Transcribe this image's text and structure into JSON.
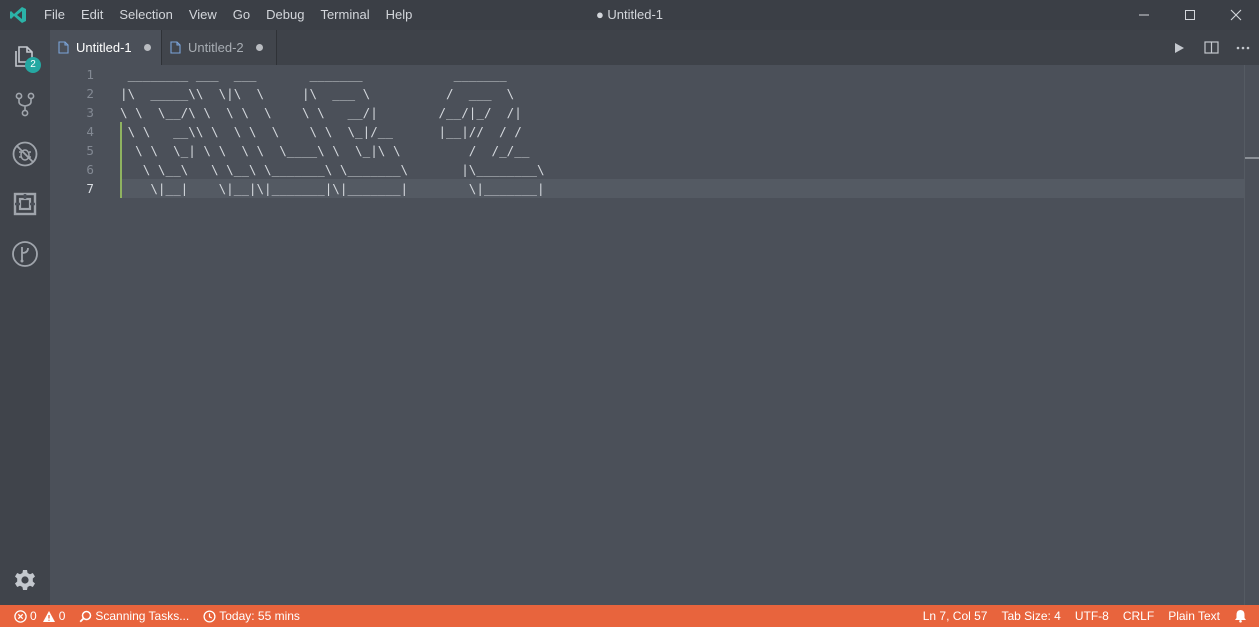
{
  "titlebar": {
    "menu": [
      "File",
      "Edit",
      "Selection",
      "View",
      "Go",
      "Debug",
      "Terminal",
      "Help"
    ],
    "title": "● Untitled-1",
    "controls": [
      "minimize-icon",
      "maximize-icon",
      "close-icon"
    ]
  },
  "activitybar": {
    "items": [
      "files-icon",
      "source-control-icon",
      "no-debug-icon",
      "extensions-icon",
      "git-graph-icon"
    ],
    "explorer_badge": "2",
    "bottom": "settings-gear-icon"
  },
  "tabs": [
    {
      "label": "Untitled-1",
      "active": true,
      "dirty": true
    },
    {
      "label": "Untitled-2",
      "active": false,
      "dirty": true
    }
  ],
  "editor_actions": [
    "run-icon",
    "split-editor-icon",
    "more-actions-icon"
  ],
  "editor": {
    "line_numbers": [
      "1",
      "2",
      "3",
      "4",
      "5",
      "6",
      "7"
    ],
    "current_line": 7,
    "lines": [
      " ________ ___  ___       _______            _______",
      "|\\  _____\\\\  \\|\\  \\     |\\  ___ \\          /  ___  \\",
      "\\ \\  \\__/\\ \\  \\ \\  \\    \\ \\   __/|        /__/|_/  /|",
      " \\ \\   __\\\\ \\  \\ \\  \\    \\ \\  \\_|/__      |__|//  / /",
      "  \\ \\  \\_| \\ \\  \\ \\  \\____\\ \\  \\_|\\ \\         /  /_/__",
      "   \\ \\__\\   \\ \\__\\ \\_______\\ \\_______\\       |\\________\\",
      "    \\|__|    \\|__|\\|_______|\\|_______|        \\|_______|"
    ]
  },
  "statusbar": {
    "errors": "0",
    "warnings": "0",
    "tasks": "Scanning Tasks...",
    "time": "Today: 55 mins",
    "position": "Ln 7, Col 57",
    "tab_size": "Tab Size: 4",
    "encoding": "UTF-8",
    "eol": "CRLF",
    "language": "Plain Text"
  },
  "colors": {
    "accent": "#e8643d",
    "badge": "#25a8a2",
    "logo": "#2bb3a8",
    "change_bar": "#8fb360"
  }
}
